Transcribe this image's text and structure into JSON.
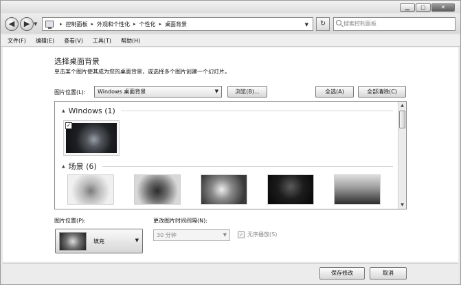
{
  "window": {
    "minimize": "▁",
    "maximize": "▢",
    "close": "✕"
  },
  "nav": {
    "back": "◀",
    "forward": "▶",
    "history": "▼",
    "refresh": "↻"
  },
  "address": {
    "crumbs": [
      "控制面板",
      "外观和个性化",
      "个性化",
      "桌面背景"
    ],
    "separator": "▸",
    "dropdown": "▼"
  },
  "search": {
    "placeholder": "搜索控制面板"
  },
  "menu": [
    "文件(F)",
    "编辑(E)",
    "查看(V)",
    "工具(T)",
    "帮助(H)"
  ],
  "page": {
    "title": "选择桌面背景",
    "description": "单击某个图片使其成为您的桌面背景，或选择多个图片创建一个幻灯片。"
  },
  "location": {
    "label": "图片位置(L):",
    "value": "Windows 桌面背景",
    "browse_button": "浏览(B)...",
    "select_all_button": "全选(A)",
    "clear_all_button": "全部清除(C)"
  },
  "gallery": {
    "groups": [
      {
        "label": "Windows (1)",
        "collapse_icon": "▲"
      },
      {
        "label": "场景 (6)",
        "collapse_icon": "▲"
      }
    ],
    "windows_item_checked": "✓",
    "scroll_up": "▲",
    "scroll_down": "▼"
  },
  "position": {
    "label": "图片位置(P):",
    "value": "填充",
    "caret": "▼"
  },
  "interval": {
    "label": "更改图片时间间隔(N):",
    "value": "30 分钟",
    "caret": "▼"
  },
  "shuffle": {
    "label": "无序播放(S)",
    "checked": "✓"
  },
  "footer": {
    "save_button": "保存修改",
    "cancel_button": "取消"
  }
}
